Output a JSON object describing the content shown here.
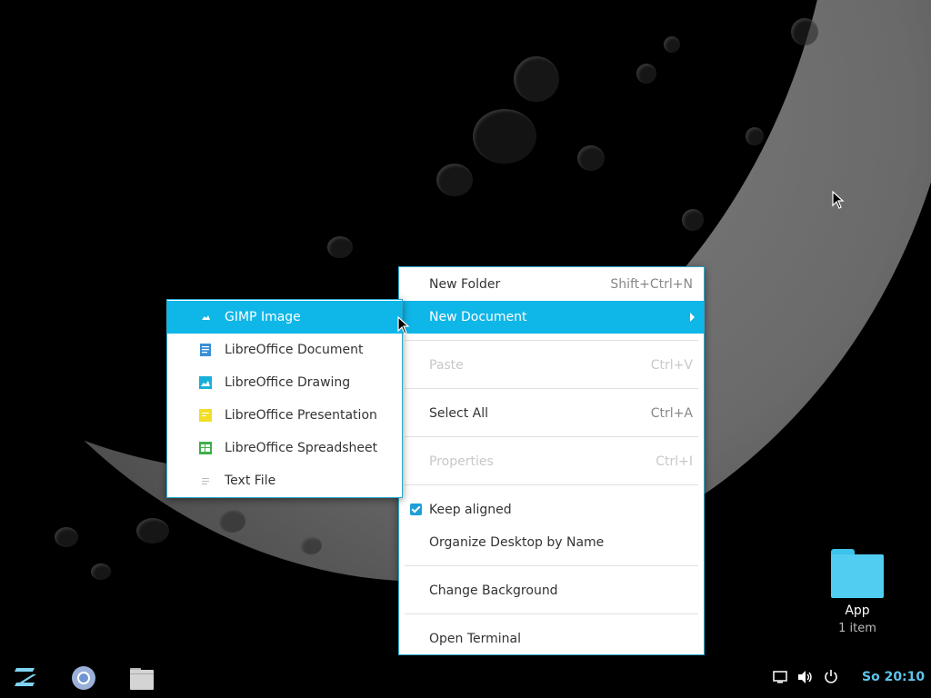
{
  "main_menu": {
    "items": [
      {
        "label": "New Folder",
        "shortcut": "Shift+Ctrl+N"
      },
      {
        "label": "New Document"
      },
      {
        "label": "Paste",
        "shortcut": "Ctrl+V"
      },
      {
        "label": "Select All",
        "shortcut": "Ctrl+A"
      },
      {
        "label": "Properties",
        "shortcut": "Ctrl+I"
      },
      {
        "label": "Keep aligned",
        "checked": true
      },
      {
        "label": "Organize Desktop by Name"
      },
      {
        "label": "Change Background"
      },
      {
        "label": "Open Terminal"
      }
    ]
  },
  "sub_menu": {
    "items": [
      {
        "label": "GIMP Image",
        "icon": "image-icon"
      },
      {
        "label": "LibreOffice Document",
        "icon": "document-icon"
      },
      {
        "label": "LibreOffice Drawing",
        "icon": "drawing-icon"
      },
      {
        "label": "LibreOffice Presentation",
        "icon": "presentation-icon"
      },
      {
        "label": "LibreOffice Spreadsheet",
        "icon": "spreadsheet-icon"
      },
      {
        "label": "Text File",
        "icon": "text-file-icon"
      }
    ]
  },
  "desktop": {
    "icon_label": "App",
    "icon_meta": "1 item"
  },
  "taskbar": {
    "clock": "So 20:10"
  },
  "colors": {
    "accent": "#0fb6e8",
    "menu_border": "#2ea7c9",
    "clock": "#5ec4ec"
  }
}
